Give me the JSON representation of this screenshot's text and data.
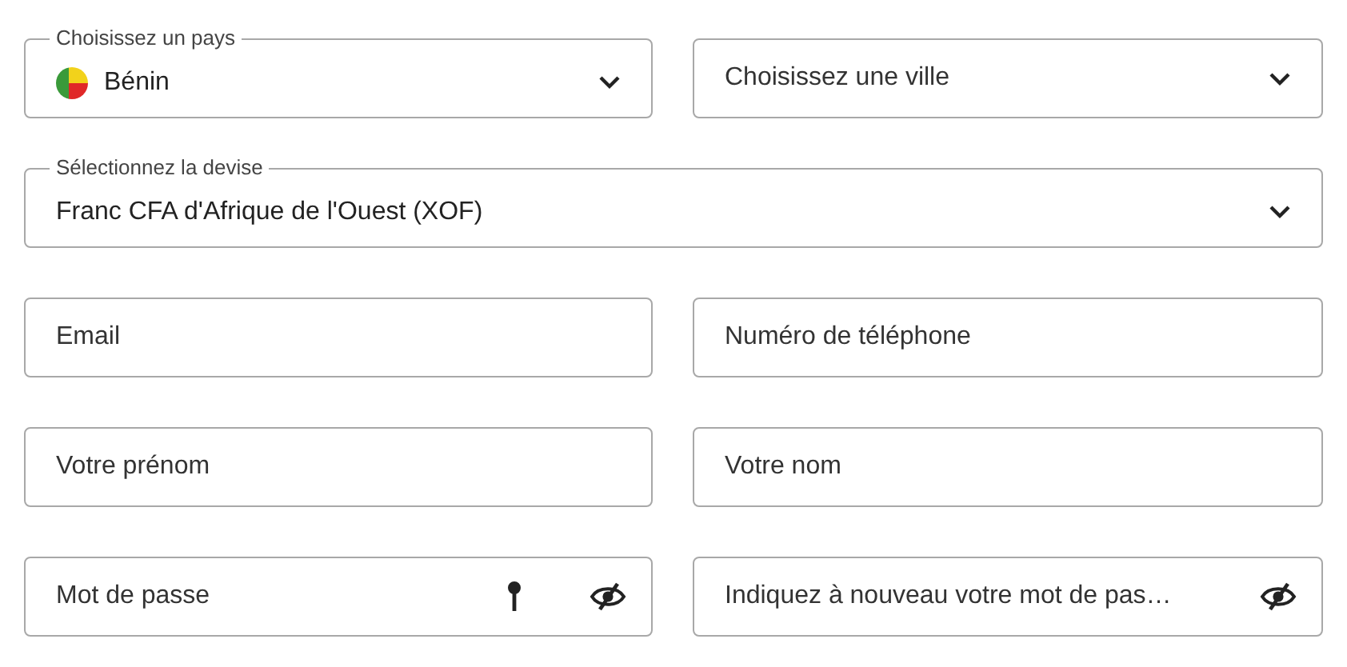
{
  "rows": [
    [
      {
        "kind": "country-select",
        "label": "Choisissez un pays",
        "value": "Bénin"
      },
      {
        "kind": "select",
        "placeholder": "Choisissez une ville"
      }
    ],
    [
      {
        "kind": "select",
        "label": "Sélectionnez la devise",
        "value": "Franc CFA d'Afrique de l'Ouest (XOF)"
      }
    ],
    [
      {
        "kind": "input",
        "placeholder": "Email"
      },
      {
        "kind": "input",
        "placeholder": "Numéro de téléphone"
      }
    ],
    [
      {
        "kind": "input",
        "placeholder": "Votre prénom"
      },
      {
        "kind": "input",
        "placeholder": "Votre nom"
      }
    ],
    [
      {
        "kind": "password",
        "placeholder": "Mot de passe",
        "key_hint": true
      },
      {
        "kind": "password",
        "placeholder": "Indiquez à nouveau votre mot de pas…",
        "key_hint": false
      }
    ]
  ]
}
